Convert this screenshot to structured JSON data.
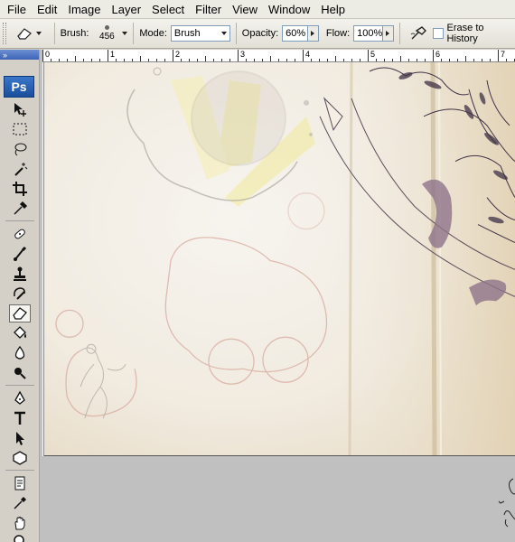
{
  "menu": [
    "File",
    "Edit",
    "Image",
    "Layer",
    "Select",
    "Filter",
    "View",
    "Window",
    "Help"
  ],
  "options": {
    "brush_label": "Brush:",
    "brush_size": "456",
    "mode_label": "Mode:",
    "mode_value": "Brush",
    "opacity_label": "Opacity:",
    "opacity_value": "60%",
    "flow_label": "Flow:",
    "flow_value": "100%",
    "erase_history_label": "Erase to History"
  },
  "toolbox": {
    "logo": "Ps",
    "header": "»",
    "tools": [
      "move-icon",
      "marquee-icon",
      "lasso-icon",
      "magic-wand-icon",
      "crop-icon",
      "eyedropper-icon",
      "healing-brush-icon",
      "brush-icon",
      "clone-stamp-icon",
      "history-brush-icon",
      "eraser-icon",
      "paint-bucket-icon",
      "blur-icon",
      "dodge-icon",
      "pen-icon",
      "type-icon",
      "path-selection-icon",
      "shape-icon",
      "notes-icon",
      "eyedropper-icon",
      "hand-icon",
      "zoom-icon"
    ],
    "active_tool": "eraser-icon"
  },
  "ruler": {
    "labels": [
      "0",
      "1",
      "2",
      "3",
      "4",
      "5",
      "6",
      "7"
    ]
  },
  "colors": {
    "accent": "#1a4e9c",
    "canvas_paper": "#f2ece2"
  }
}
